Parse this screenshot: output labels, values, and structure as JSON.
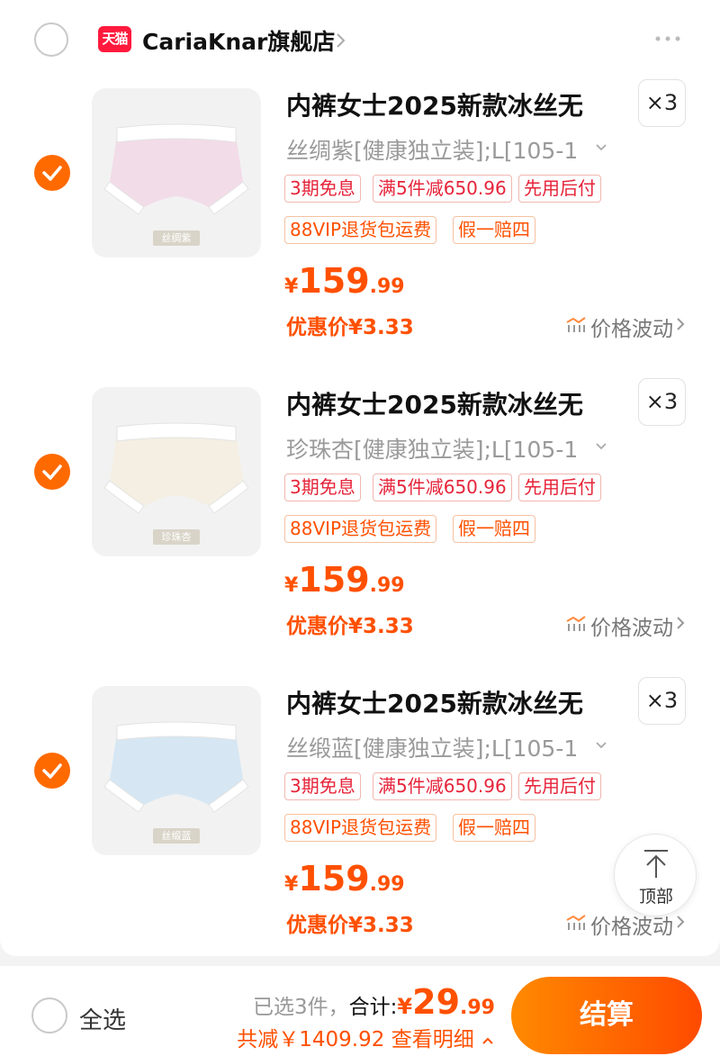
{
  "shop": {
    "badge": "天猫",
    "name": "CariaKnar旗舰店"
  },
  "items": [
    {
      "title": "内裤女士2025新款冰丝无",
      "quantity": "×3",
      "sku": "丝绸紫[健康独立装];L[105-1",
      "thumb_tag": "丝绸紫",
      "thumb_color": "#f2dce8",
      "tags_row1": [
        "3期免息",
        "满5件减650.96",
        "先用后付"
      ],
      "tags_row2": [
        "88VIP退货包运费",
        "假一赔四"
      ],
      "price_currency": "¥",
      "price_int": "159",
      "price_dec": ".99",
      "promo": "优惠价¥3.33",
      "trend": "价格波动",
      "selected": true
    },
    {
      "title": "内裤女士2025新款冰丝无",
      "quantity": "×3",
      "sku": "珍珠杏[健康独立装];L[105-1",
      "thumb_tag": "珍珠杏",
      "thumb_color": "#f4efe2",
      "tags_row1": [
        "3期免息",
        "满5件减650.96",
        "先用后付"
      ],
      "tags_row2": [
        "88VIP退货包运费",
        "假一赔四"
      ],
      "price_currency": "¥",
      "price_int": "159",
      "price_dec": ".99",
      "promo": "优惠价¥3.33",
      "trend": "价格波动",
      "selected": true
    },
    {
      "title": "内裤女士2025新款冰丝无",
      "quantity": "×3",
      "sku": "丝缎蓝[健康独立装];L[105-1",
      "thumb_tag": "丝缎蓝",
      "thumb_color": "#d6e7f3",
      "tags_row1": [
        "3期免息",
        "满5件减650.96",
        "先用后付"
      ],
      "tags_row2": [
        "88VIP退货包运费",
        "假一赔四"
      ],
      "price_currency": "¥",
      "price_int": "159",
      "price_dec": ".99",
      "promo": "优惠价¥3.33",
      "trend": "价格波动",
      "selected": true
    }
  ],
  "top_button": {
    "label": "顶部"
  },
  "footer": {
    "select_all": "全选",
    "selected_count": "已选3件，",
    "total_label": "合计:",
    "total_currency": "¥",
    "total_int": "29",
    "total_dec": ".99",
    "discount": "共减￥1409.92",
    "detail_link": "查看明细",
    "checkout": "结算"
  },
  "colors": {
    "accent": "#ff5000",
    "tmall_red": "#ff1a3d",
    "check_orange": "#ff6a00"
  }
}
